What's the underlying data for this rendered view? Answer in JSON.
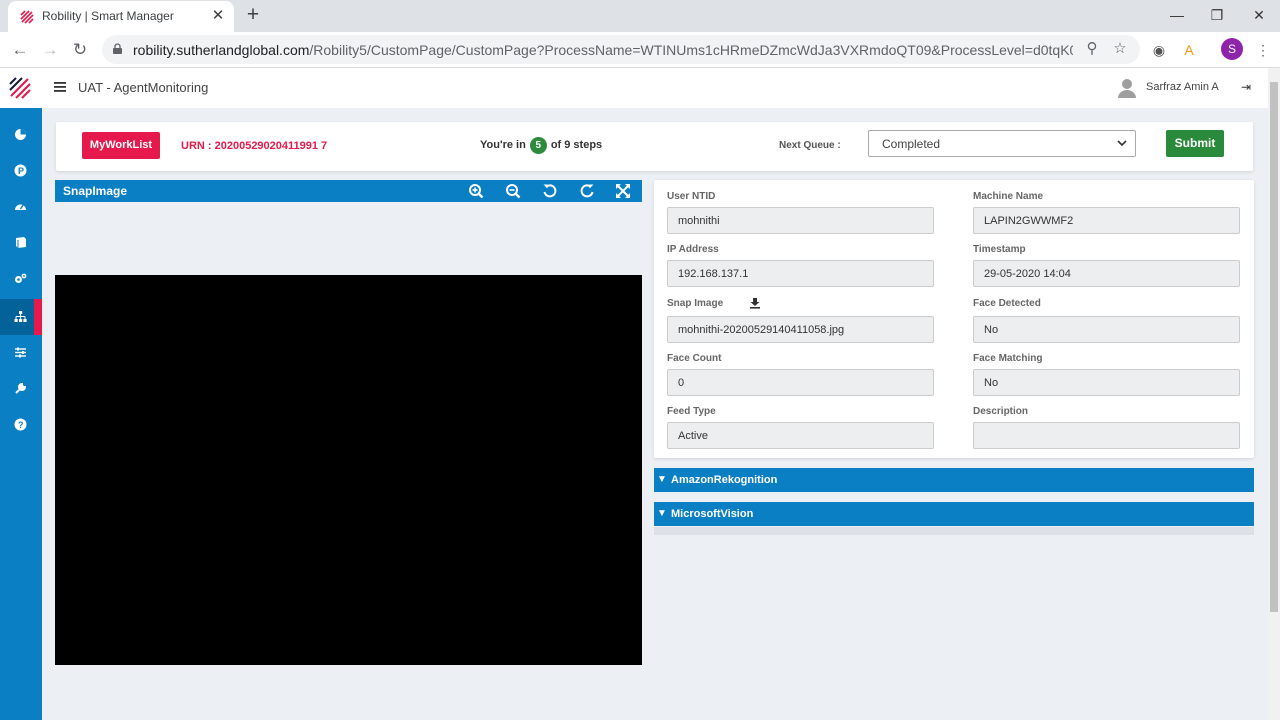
{
  "browser": {
    "tab_title": "Robility | Smart Manager",
    "url_host": "robility.sutherlandglobal.com",
    "url_rest": "/Robility5/CustomPage/CustomPage?ProcessName=WTINUms1cHRmeDZmcWdJa3VXRmdoQT09&ProcessLevel=d0tqK0QrM2hKT...",
    "profile_initial": "S"
  },
  "app": {
    "title": "UAT - AgentMonitoring",
    "user_name": "Sarfraz Amin A"
  },
  "topbar": {
    "worklist_label": "MyWorkList",
    "urn": "URN : 20200529020411991 7",
    "steps_prefix": "You're in",
    "steps_current": "5",
    "steps_suffix": "of 9 steps",
    "next_queue_label": "Next Queue :",
    "next_queue_value": "Completed",
    "submit_label": "Submit"
  },
  "snap_panel": {
    "title": "SnapImage"
  },
  "details": {
    "user_ntid_label": "User NTID",
    "user_ntid": "mohnithi",
    "machine_name_label": "Machine Name",
    "machine_name": "LAPIN2GWWMF2",
    "ip_address_label": "IP Address",
    "ip_address": "192.168.137.1",
    "timestamp_label": "Timestamp",
    "timestamp": "29-05-2020 14:04",
    "snap_image_label": "Snap Image",
    "snap_image": "mohnithi-20200529140411058.jpg",
    "face_detected_label": "Face Detected",
    "face_detected": "No",
    "face_count_label": "Face Count",
    "face_count": "0",
    "face_matching_label": "Face Matching",
    "face_matching": "No",
    "feed_type_label": "Feed Type",
    "feed_type": "Active",
    "description_label": "Description",
    "description": ""
  },
  "accordions": [
    {
      "label": "AmazonRekognition"
    },
    {
      "label": "MicrosoftVision"
    }
  ],
  "colors": {
    "primary_blue": "#0a7fc4",
    "accent_red": "#e5194b",
    "success_green": "#2a8a3b"
  }
}
